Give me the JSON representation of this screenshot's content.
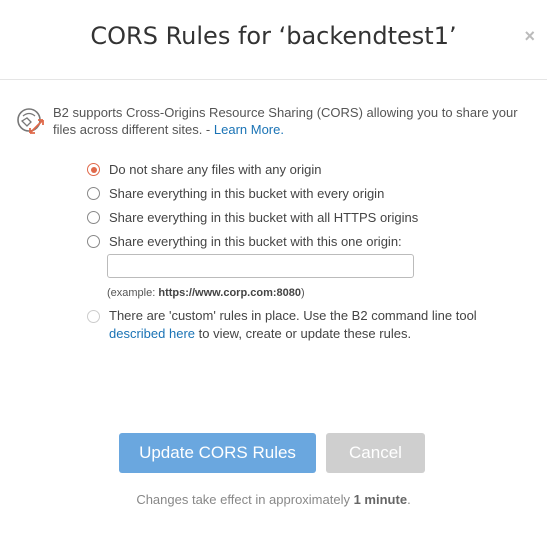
{
  "dialog": {
    "title": "CORS Rules for ‘backendtest1’",
    "close_glyph": "×"
  },
  "info": {
    "icon": "cors-share-icon",
    "text": "B2 supports Cross-Origins Resource Sharing (CORS) allowing you to share your files across different sites. - ",
    "link_label": "Learn More."
  },
  "options": [
    {
      "label": "Do not share any files with any origin",
      "checked": true
    },
    {
      "label": "Share everything in this bucket with every origin",
      "checked": false
    },
    {
      "label": "Share everything in this bucket with all HTTPS origins",
      "checked": false
    },
    {
      "label": "Share everything in this bucket with this one origin:",
      "checked": false
    }
  ],
  "origin_input": {
    "value": "",
    "placeholder": ""
  },
  "example": {
    "prefix": "(example: ",
    "url": "https://www.corp.com:8080",
    "suffix": ")"
  },
  "custom": {
    "text_before": "There are 'custom' rules in place. Use the B2 command line tool ",
    "link_label": "described here",
    "text_after": " to view, create or update these rules.",
    "disabled": true
  },
  "buttons": {
    "update_label": "Update CORS Rules",
    "cancel_label": "Cancel"
  },
  "footer": {
    "prefix": "Changes take effect in approximately ",
    "bold": "1 minute",
    "suffix": "."
  },
  "colors": {
    "accent": "#e0694a",
    "primary_button": "#6aa7df",
    "cancel_button": "#cfcfcf",
    "link": "#1a73b5"
  }
}
